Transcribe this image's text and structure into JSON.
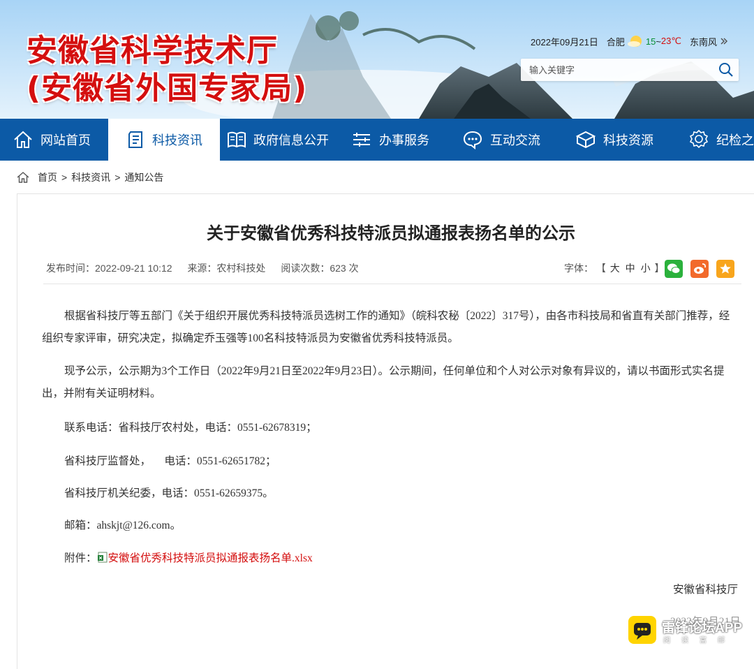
{
  "header": {
    "site_title": "安徽省科学技术厅",
    "site_subtitle": "(安徽省外国专家局)",
    "date": "2022年09月21日",
    "city": "合肥",
    "weather_icon": "sun-icon",
    "temp_low": "15",
    "temp_sep": "~",
    "temp_high": "23℃",
    "wind": "东南风",
    "search_placeholder": "输入关键字"
  },
  "nav": {
    "items": [
      {
        "label": "网站首页",
        "icon": "home-icon"
      },
      {
        "label": "科技资讯",
        "icon": "document-icon",
        "active": true
      },
      {
        "label": "政府信息公开",
        "icon": "book-icon"
      },
      {
        "label": "办事服务",
        "icon": "service-icon"
      },
      {
        "label": "互动交流",
        "icon": "chat-icon"
      },
      {
        "label": "科技资源",
        "icon": "cube-icon"
      },
      {
        "label": "纪检之",
        "icon": "badge-icon"
      }
    ]
  },
  "breadcrumb": {
    "home": "首页",
    "sep": ">",
    "level1": "科技资讯",
    "level2": "通知公告"
  },
  "article": {
    "title": "关于安徽省优秀科技特派员拟通报表扬名单的公示",
    "publish_time": "发布时间：2022-09-21 10:12",
    "source": "来源：农村科技处",
    "views": "阅读次数：623 次",
    "font_label": "字体：",
    "font_open": "【",
    "font_large": "大",
    "font_medium": "中",
    "font_small": "小",
    "font_close": "】",
    "share_icons": [
      "wechat-icon",
      "weibo-icon",
      "favorite-icon"
    ],
    "paragraph1": "根据省科技厅等五部门《关于组织开展优秀科技特派员选树工作的通知》（皖科农秘〔2022〕317号），由各市科技局和省直有关部门推荐，经组织专家评审，研究决定，拟确定乔玉强等100名科技特派员为安徽省优秀科技特派员。",
    "paragraph2": "现予公示，公示期为3个工作日（2022年9月21日至2022年9月23日）。公示期间，任何单位和个人对公示对象有异议的，请以书面形式实名提出，并附有关证明材料。",
    "contact1": "联系电话：省科技厅农村处，电话：0551-62678319；",
    "contact2": "省科技厅监督处，     电话：0551-62651782；",
    "contact3": "省科技厅机关纪委，电话：0551-62659375。",
    "email": "邮箱：ahskjt@126.com。",
    "attachment_label": "附件：",
    "attachment_icon": "excel-file-icon",
    "attachment_name": "安徽省优秀科技特派员拟通报表扬名单.xlsx",
    "signature": "安徽省科技厅",
    "sign_date": "2022年9月21日"
  },
  "watermark": {
    "text": "雷锋论坛APP",
    "sub": "阅读富邮"
  },
  "colors": {
    "nav_bg": "#0c5aa6",
    "title_red": "#d40f0f",
    "link_red": "#d40f0f"
  }
}
